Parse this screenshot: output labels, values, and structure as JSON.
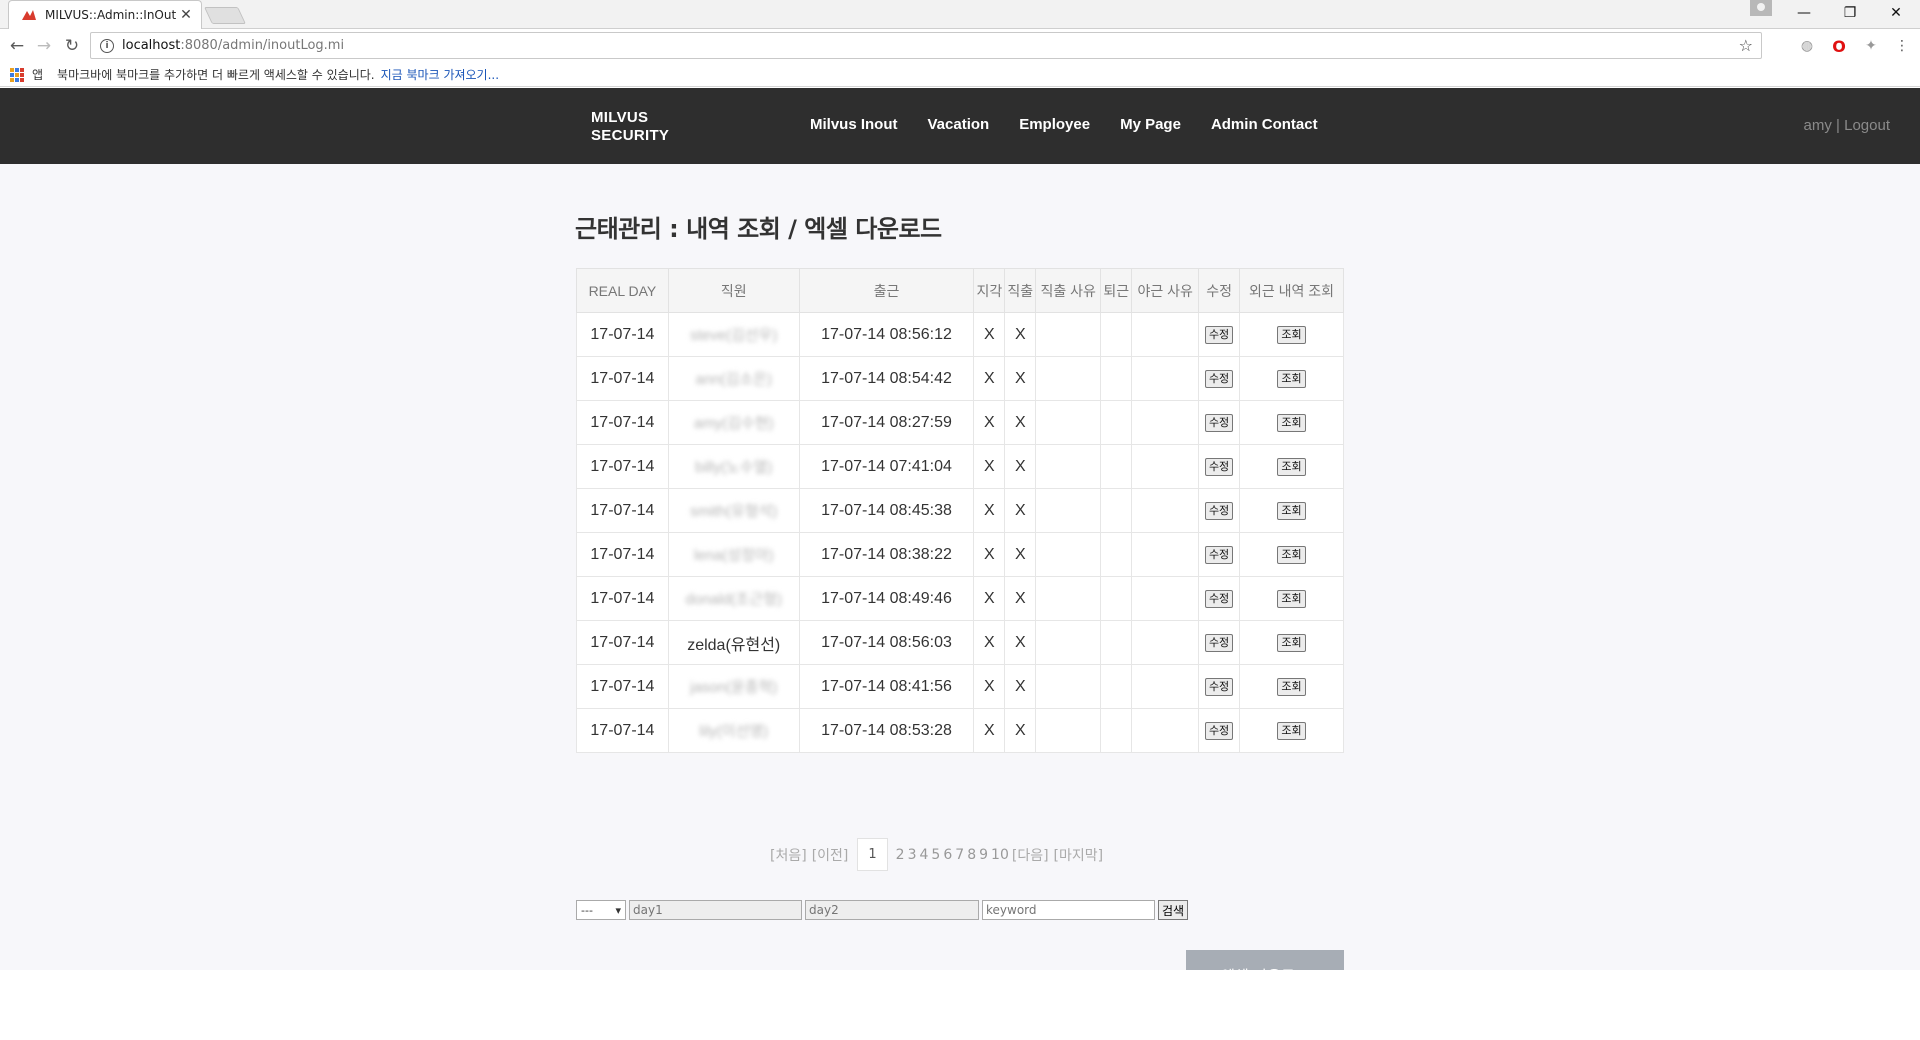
{
  "browser": {
    "tab_title": "MILVUS::Admin::InOut L",
    "tab_close": "✕",
    "url_host": "localhost",
    "url_rest": ":8080/admin/inoutLog.mi",
    "bookmarks_apps": "앱",
    "bookmarks_message": "북마크바에 북마크를 추가하면 더 빠르게 액세스할 수 있습니다.",
    "bookmarks_import": "지금 북마크 가져오기..."
  },
  "header": {
    "logo_line1": "MILVUS",
    "logo_line2": "SECURITY",
    "nav": [
      "Milvus Inout",
      "Vacation",
      "Employee",
      "My Page",
      "Admin Contact"
    ],
    "user": "amy | Logout"
  },
  "main": {
    "title": "근태관리 : 내역 조회 / 엑셀 다운로드",
    "columns": [
      "REAL DAY",
      "직원",
      "출근",
      "지각",
      "직출",
      "직출 사유",
      "퇴근",
      "야근 사유",
      "수정",
      "외근 내역 조회"
    ],
    "edit_label": "수정",
    "view_label": "조회",
    "rows": [
      {
        "day": "17-07-14",
        "employee": "steve(김선우)",
        "in": "17-07-14 08:56:12",
        "late": "X",
        "direct": "X",
        "direct_reason": "",
        "out": "",
        "overtime_reason": ""
      },
      {
        "day": "17-07-14",
        "employee": "ann(김소은)",
        "in": "17-07-14 08:54:42",
        "late": "X",
        "direct": "X",
        "direct_reason": "",
        "out": "",
        "overtime_reason": ""
      },
      {
        "day": "17-07-14",
        "employee": "amy(김수현)",
        "in": "17-07-14 08:27:59",
        "late": "X",
        "direct": "X",
        "direct_reason": "",
        "out": "",
        "overtime_reason": ""
      },
      {
        "day": "17-07-14",
        "employee": "billy(노수열)",
        "in": "17-07-14 07:41:04",
        "late": "X",
        "direct": "X",
        "direct_reason": "",
        "out": "",
        "overtime_reason": ""
      },
      {
        "day": "17-07-14",
        "employee": "smith(유형석)",
        "in": "17-07-14 08:45:38",
        "late": "X",
        "direct": "X",
        "direct_reason": "",
        "out": "",
        "overtime_reason": ""
      },
      {
        "day": "17-07-14",
        "employee": "lena(성정아)",
        "in": "17-07-14 08:38:22",
        "late": "X",
        "direct": "X",
        "direct_reason": "",
        "out": "",
        "overtime_reason": ""
      },
      {
        "day": "17-07-14",
        "employee": "donald(조근형)",
        "in": "17-07-14 08:49:46",
        "late": "X",
        "direct": "X",
        "direct_reason": "",
        "out": "",
        "overtime_reason": ""
      },
      {
        "day": "17-07-14",
        "employee": "zelda(유현선)",
        "in": "17-07-14 08:56:03",
        "late": "X",
        "direct": "X",
        "direct_reason": "",
        "out": "",
        "overtime_reason": ""
      },
      {
        "day": "17-07-14",
        "employee": "jason(윤종혁)",
        "in": "17-07-14 08:41:56",
        "late": "X",
        "direct": "X",
        "direct_reason": "",
        "out": "",
        "overtime_reason": ""
      },
      {
        "day": "17-07-14",
        "employee": "lily(이선영)",
        "in": "17-07-14 08:53:28",
        "late": "X",
        "direct": "X",
        "direct_reason": "",
        "out": "",
        "overtime_reason": ""
      }
    ],
    "blurred_rows": [
      0,
      1,
      2,
      3,
      4,
      5,
      6,
      8,
      9
    ]
  },
  "pagination": {
    "first": "[처음]",
    "prev": "[이전]",
    "current": "1",
    "pages": [
      "2",
      "3",
      "4",
      "5",
      "6",
      "7",
      "8",
      "9",
      "10"
    ],
    "next": "[다음]",
    "last": "[마지막]"
  },
  "search": {
    "select_value": "---",
    "day1_placeholder": "day1",
    "day2_placeholder": "day2",
    "keyword_placeholder": "keyword",
    "button": "검색"
  },
  "excel_button": "엑셀 다운로드",
  "colors": {
    "header_bg": "#2e2e2e",
    "content_bg": "#f7f7fa",
    "excel_button_bg": "#a7adb5"
  }
}
